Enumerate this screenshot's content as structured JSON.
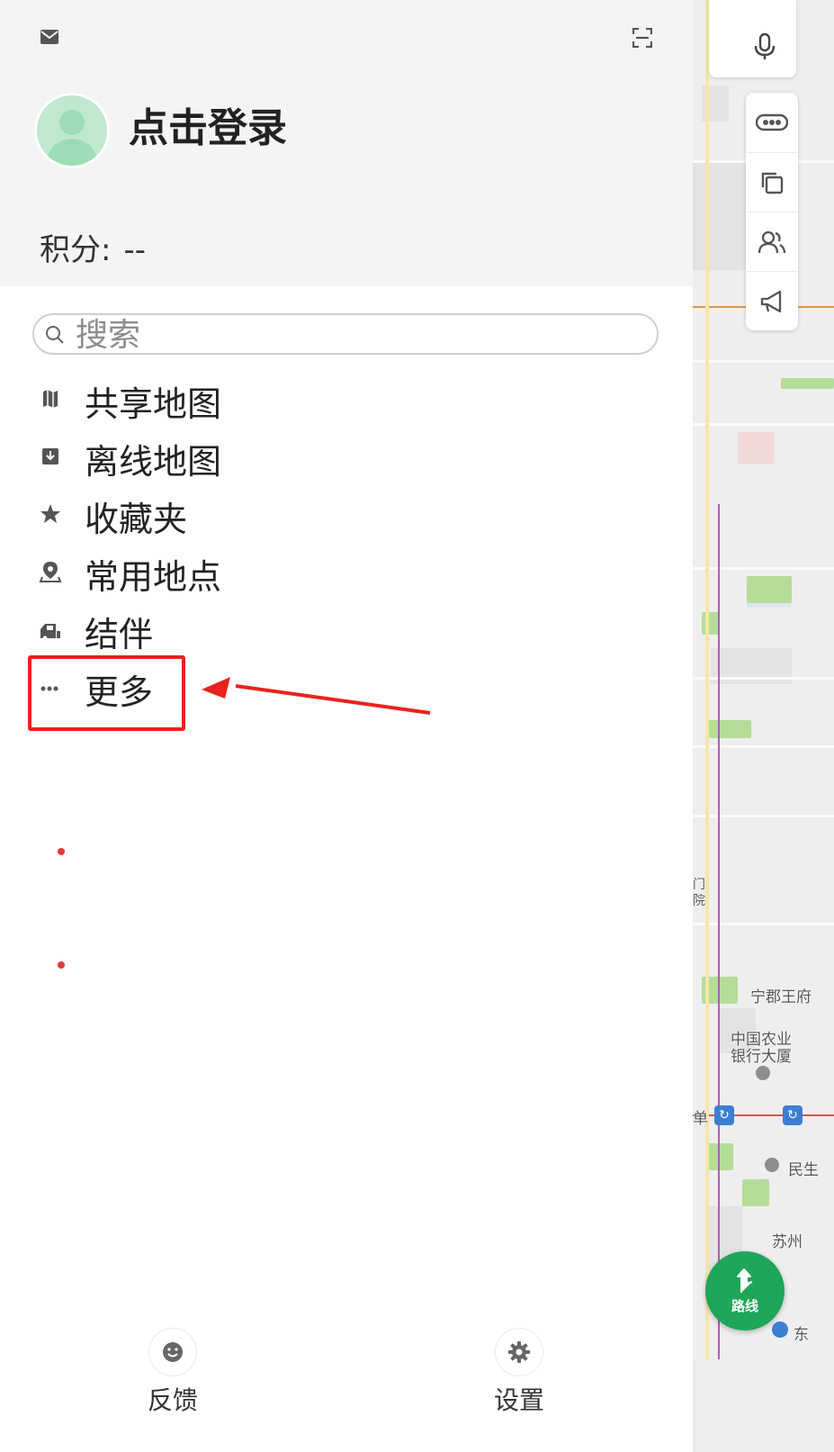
{
  "drawer": {
    "login_text": "点击登录",
    "points_label": "积分:",
    "points_value": "--",
    "search_placeholder": "搜索",
    "menu_items": [
      {
        "label": "共享地图",
        "icon": "map-icon"
      },
      {
        "label": "离线地图",
        "icon": "download-icon"
      },
      {
        "label": "收藏夹",
        "icon": "star-icon"
      },
      {
        "label": "常用地点",
        "icon": "location-pin-icon"
      },
      {
        "label": "结伴",
        "icon": "travel-companion-icon",
        "badge": true
      },
      {
        "label": "更多",
        "icon": "more-dots-icon",
        "badge": true
      }
    ],
    "footer": {
      "feedback_label": "反馈",
      "settings_label": "设置"
    }
  },
  "map": {
    "labels": {
      "ningjun": "宁郡王府",
      "bank_line1": "中国农业",
      "bank_line2": "银行大厦",
      "xidan": "单",
      "minsheng": "民生",
      "suzhou": "苏州",
      "dong": "东",
      "side1": "门",
      "side2": "院"
    },
    "route_button_label": "路线"
  },
  "colors": {
    "accent_green": "#1fa65a",
    "highlight_red": "#e8221e",
    "badge_red": "#e53935"
  }
}
